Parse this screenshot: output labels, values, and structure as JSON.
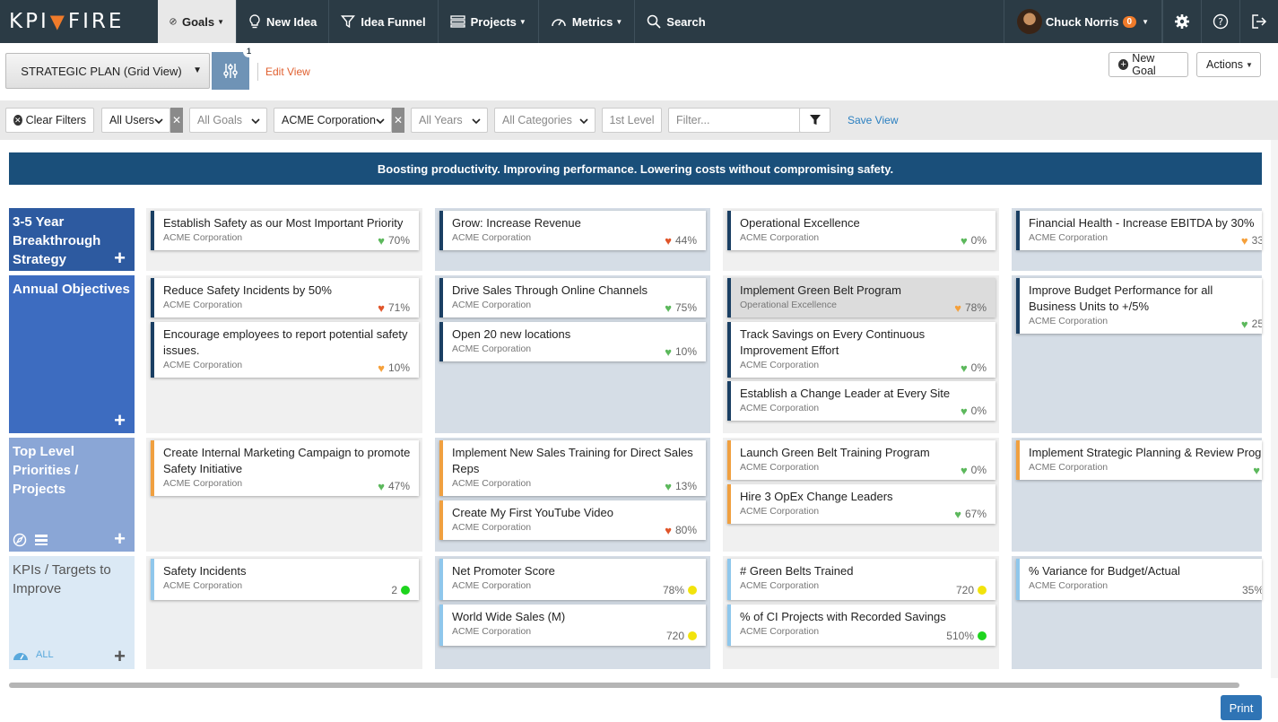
{
  "nav": {
    "logo_left": "KPI",
    "logo_right": "FIRE",
    "goals": "Goals",
    "new_idea": "New Idea",
    "idea_funnel": "Idea Funnel",
    "projects": "Projects",
    "metrics": "Metrics",
    "search": "Search",
    "user_name": "Chuck Norris",
    "notification_count": "0"
  },
  "view": {
    "selected": "STRATEGIC PLAN (Grid View)",
    "filter_count": "1",
    "edit_view": "Edit View",
    "new_goal": "New Goal",
    "actions": "Actions"
  },
  "filters": {
    "clear": "Clear Filters",
    "users": "All Users",
    "goals": "All Goals",
    "company": "ACME Corporation",
    "years": "All Years",
    "categories": "All Categories",
    "level": "1st Level",
    "placeholder": "Filter...",
    "save_view": "Save View"
  },
  "banner": "Boosting productivity. Improving performance. Lowering costs without compromising safety.",
  "rows": [
    {
      "label": "3-5 Year Breakthrough Strategy",
      "color": "#2d5aa0"
    },
    {
      "label": "Annual Objectives",
      "color": "#3d6cc0"
    },
    {
      "label": "Top Level Priorities / Projects",
      "color": "#8aa6d6"
    },
    {
      "label": "KPIs / Targets to Improve",
      "color": "#dbe9f5",
      "all": "ALL"
    }
  ],
  "cards": {
    "c1": {
      "title": "Establish Safety as our Most Important Priority",
      "org": "ACME Corporation",
      "value": "70%",
      "status": "green"
    },
    "c2": {
      "title": "Grow: Increase Revenue",
      "org": "ACME Corporation",
      "value": "44%",
      "status": "red"
    },
    "c3": {
      "title": "Operational Excellence",
      "org": "ACME Corporation",
      "value": "0%",
      "status": "green"
    },
    "c4": {
      "title": "Financial Health - Increase EBITDA by 30%",
      "org": "ACME Corporation",
      "value": "33",
      "status": "orange"
    },
    "c5": {
      "title": "Reduce Safety Incidents by 50%",
      "org": "ACME Corporation",
      "value": "71%",
      "status": "red"
    },
    "c6": {
      "title": "Encourage employees to report potential safety issues.",
      "org": "ACME Corporation",
      "value": "10%",
      "status": "orange"
    },
    "c7": {
      "title": "Drive Sales Through Online Channels",
      "org": "ACME Corporation",
      "value": "75%",
      "status": "green"
    },
    "c8": {
      "title": "Open 20 new locations",
      "org": "ACME Corporation",
      "value": "10%",
      "status": "green"
    },
    "c9": {
      "title": "Implement Green Belt Program",
      "org": "Operational Excellence",
      "value": "78%",
      "status": "orange"
    },
    "c10": {
      "title": "Track Savings on Every Continuous Improvement Effort",
      "org": "ACME Corporation",
      "value": "0%",
      "status": "green"
    },
    "c11": {
      "title": "Establish a Change Leader at Every Site",
      "org": "ACME Corporation",
      "value": "0%",
      "status": "green"
    },
    "c12": {
      "title": "Improve Budget Performance for all Business Units to +/5%",
      "org": "ACME Corporation",
      "value": "25",
      "status": "green"
    },
    "c13": {
      "title": "Create Internal Marketing Campaign to promote Safety Initiative",
      "org": "ACME Corporation",
      "value": "47%",
      "status": "green"
    },
    "c14": {
      "title": "Implement New Sales Training for Direct Sales Reps",
      "org": "ACME Corporation",
      "value": "13%",
      "status": "green"
    },
    "c15": {
      "title": "Create My First YouTube Video",
      "org": "ACME Corporation",
      "value": "80%",
      "status": "red"
    },
    "c16": {
      "title": "Launch Green Belt Training Program",
      "org": "ACME Corporation",
      "value": "0%",
      "status": "green"
    },
    "c17": {
      "title": "Hire 3 OpEx Change Leaders",
      "org": "ACME Corporation",
      "value": "67%",
      "status": "green"
    },
    "c18": {
      "title": "Implement Strategic Planning & Review Progra",
      "org": "ACME Corporation",
      "value": "",
      "status": "green"
    },
    "c19": {
      "title": "Safety Incidents",
      "org": "ACME Corporation",
      "value": "2",
      "status": "bright-green"
    },
    "c20": {
      "title": "Net Promoter Score",
      "org": "ACME Corporation",
      "value": "78%",
      "status": "yellow"
    },
    "c21": {
      "title": "World Wide Sales (M)",
      "org": "ACME Corporation",
      "value": "720",
      "status": "yellow"
    },
    "c22": {
      "title": "# Green Belts Trained",
      "org": "ACME Corporation",
      "value": "720",
      "status": "yellow"
    },
    "c23": {
      "title": "% of CI Projects with Recorded Savings",
      "org": "ACME Corporation",
      "value": "510%",
      "status": "bright-green"
    },
    "c24": {
      "title": "% Variance for Budget/Actual",
      "org": "ACME Corporation",
      "value": "35%",
      "status": "none"
    }
  },
  "colors": {
    "green": "#5cb85c",
    "red": "#e0552a",
    "orange": "#f5a03a",
    "yellow": "#f2e30c",
    "bright-green": "#1ed41e"
  },
  "print": "Print"
}
